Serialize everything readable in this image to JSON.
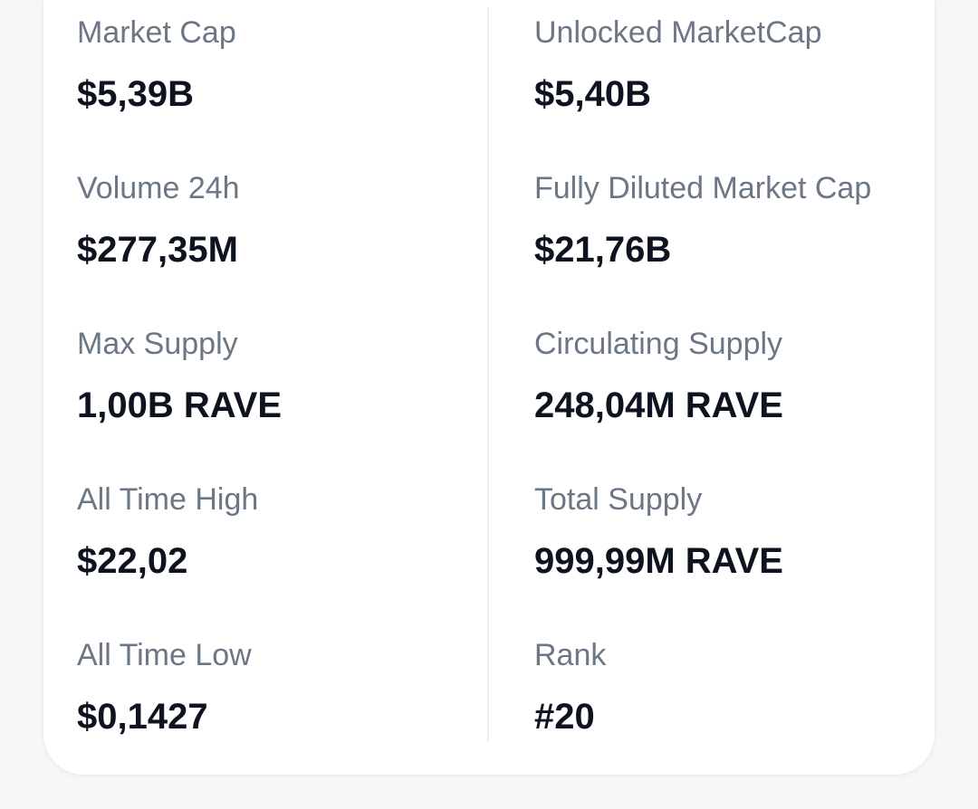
{
  "stats": {
    "left": [
      {
        "label": "Market Cap",
        "value": "$5,39B"
      },
      {
        "label": "Volume 24h",
        "value": "$277,35M"
      },
      {
        "label": "Max Supply",
        "value": "1,00B RAVE"
      },
      {
        "label": "All Time High",
        "value": "$22,02"
      },
      {
        "label": "All Time Low",
        "value": "$0,1427"
      }
    ],
    "right": [
      {
        "label": "Unlocked MarketCap",
        "value": "$5,40B"
      },
      {
        "label": "Fully Diluted Market Cap",
        "value": "$21,76B"
      },
      {
        "label": "Circulating Supply",
        "value": "248,04M RAVE"
      },
      {
        "label": "Total Supply",
        "value": "999,99M RAVE"
      },
      {
        "label": "Rank",
        "value": "#20"
      }
    ]
  },
  "colors": {
    "label": "#6b7785",
    "value": "#0e1320",
    "card": "#ffffff",
    "background": "#f7f7f8",
    "divider": "#eceff2"
  }
}
